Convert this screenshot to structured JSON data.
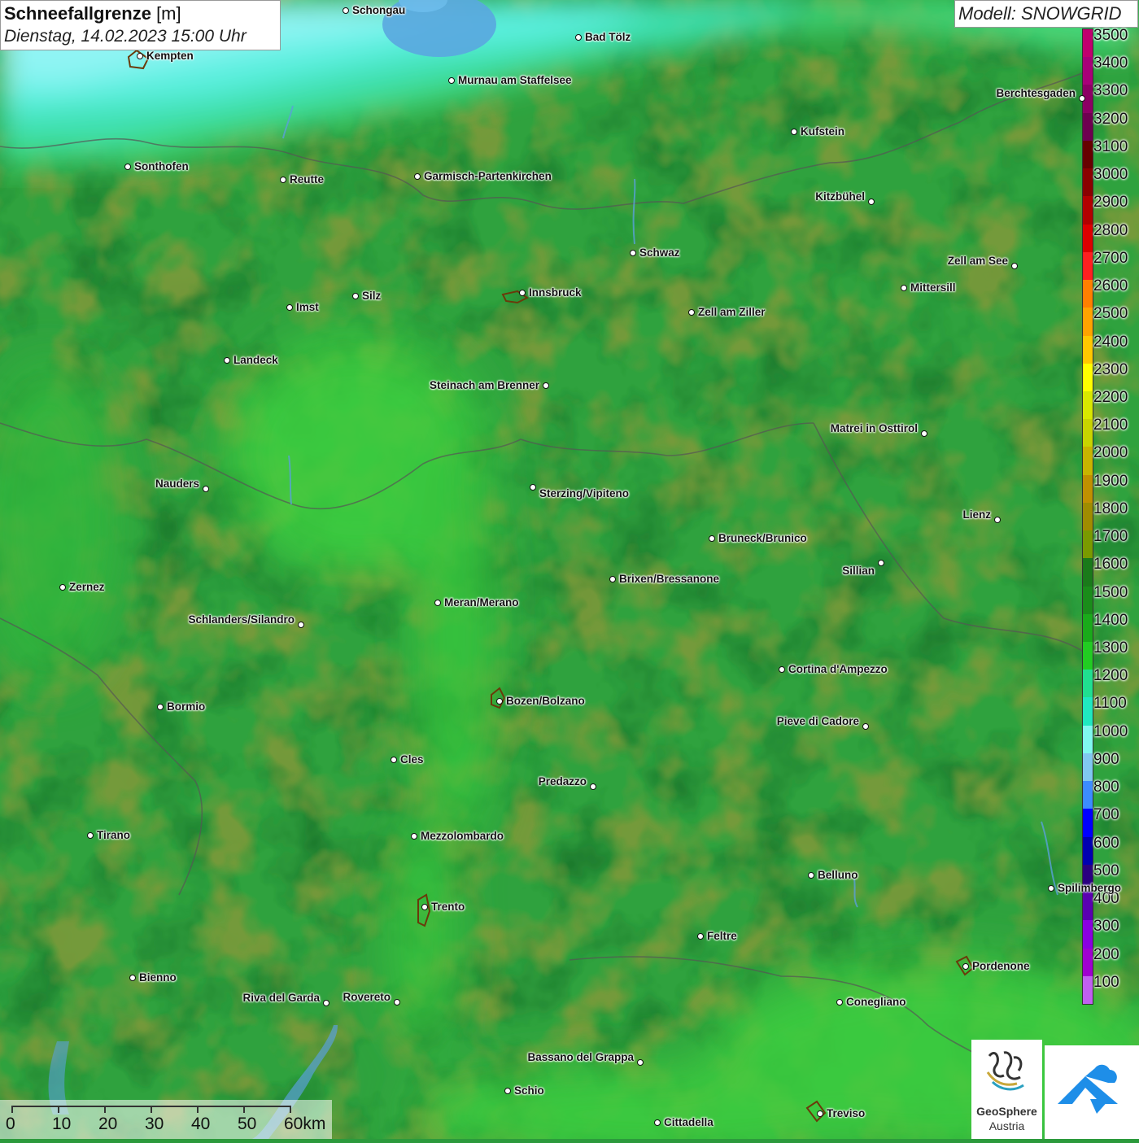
{
  "header": {
    "title_bold": "Schneefallgrenze",
    "title_unit": " [m]",
    "datetime": "Dienstag, 14.02.2023 15:00 Uhr",
    "model": "Modell: SNOWGRID"
  },
  "legend": {
    "labels": [
      "3500",
      "3400",
      "3300",
      "3200",
      "3100",
      "3000",
      "2900",
      "2800",
      "2700",
      "2600",
      "2500",
      "2400",
      "2300",
      "2200",
      "2100",
      "2000",
      "1900",
      "1800",
      "1700",
      "1600",
      "1500",
      "1400",
      "1300",
      "1200",
      "1100",
      "1000",
      "900",
      "800",
      "700",
      "600",
      "500",
      "400",
      "300",
      "200",
      "100"
    ],
    "colors": [
      "#c0006e",
      "#a80078",
      "#8c0064",
      "#6e0050",
      "#660000",
      "#8a0000",
      "#b30000",
      "#dd0000",
      "#ff2020",
      "#ff7f00",
      "#ffa300",
      "#ffc800",
      "#ffff00",
      "#d8e800",
      "#c8d400",
      "#c8b400",
      "#c09000",
      "#a08c00",
      "#7a9a00",
      "#1a7a1a",
      "#1a8c1a",
      "#1aaa1a",
      "#22cc22",
      "#20e090",
      "#20e8c0",
      "#80f8f0",
      "#80c8f0",
      "#3c8cff",
      "#0000ff",
      "#0000b0",
      "#2a0080",
      "#5a00b0",
      "#8a00e0",
      "#a000d0",
      "#c060f0"
    ]
  },
  "cities": [
    {
      "name": "Schongau",
      "side": "r"
    },
    {
      "name": "Bad Tölz",
      "side": "r"
    },
    {
      "name": "Kempten",
      "side": "r"
    },
    {
      "name": "Murnau am Staffelsee",
      "side": "r"
    },
    {
      "name": "Berchtesgaden",
      "side": "l"
    },
    {
      "name": "Kufstein",
      "side": "r"
    },
    {
      "name": "Sonthofen",
      "side": "r"
    },
    {
      "name": "Reutte",
      "side": "r"
    },
    {
      "name": "Garmisch-Partenkirchen",
      "side": "r"
    },
    {
      "name": "Kitzbühel",
      "side": "l"
    },
    {
      "name": "Schwaz",
      "side": "r"
    },
    {
      "name": "Zell am See",
      "side": "l"
    },
    {
      "name": "Innsbruck",
      "side": "r"
    },
    {
      "name": "Mittersill",
      "side": "r"
    },
    {
      "name": "Silz",
      "side": "r"
    },
    {
      "name": "Imst",
      "side": "r"
    },
    {
      "name": "Zell am Ziller",
      "side": "r"
    },
    {
      "name": "Landeck",
      "side": "r"
    },
    {
      "name": "Steinach am Brenner",
      "side": "l"
    },
    {
      "name": "Matrei in Osttirol",
      "side": "l"
    },
    {
      "name": "Nauders",
      "side": "l"
    },
    {
      "name": "Sterzing/Vipiteno",
      "side": "r"
    },
    {
      "name": "Lienz",
      "side": "l"
    },
    {
      "name": "Bruneck/Brunico",
      "side": "r"
    },
    {
      "name": "Sillian",
      "side": "l"
    },
    {
      "name": "Brixen/Bressanone",
      "side": "r"
    },
    {
      "name": "Zernez",
      "side": "r"
    },
    {
      "name": "Meran/Merano",
      "side": "r"
    },
    {
      "name": "Schlanders/Silandro",
      "side": "l"
    },
    {
      "name": "Cortina d'Ampezzo",
      "side": "r"
    },
    {
      "name": "Bozen/Bolzano",
      "side": "r"
    },
    {
      "name": "Bormio",
      "side": "r"
    },
    {
      "name": "Pieve di Cadore",
      "side": "l"
    },
    {
      "name": "Cles",
      "side": "r"
    },
    {
      "name": "Predazzo",
      "side": "l"
    },
    {
      "name": "Tirano",
      "side": "r"
    },
    {
      "name": "Mezzolombardo",
      "side": "r"
    },
    {
      "name": "Belluno",
      "side": "r"
    },
    {
      "name": "Spilimbergo",
      "side": "r"
    },
    {
      "name": "Trento",
      "side": "r"
    },
    {
      "name": "Feltre",
      "side": "r"
    },
    {
      "name": "Pordenone",
      "side": "r"
    },
    {
      "name": "Bienno",
      "side": "r"
    },
    {
      "name": "Riva del Garda",
      "side": "l"
    },
    {
      "name": "Rovereto",
      "side": "l"
    },
    {
      "name": "Conegliano",
      "side": "r"
    },
    {
      "name": "Bassano del Grappa",
      "side": "l"
    },
    {
      "name": "Schio",
      "side": "r"
    },
    {
      "name": "Treviso",
      "side": "r"
    },
    {
      "name": "Cittadella",
      "side": "r"
    }
  ],
  "scale": {
    "labels": [
      "0",
      "10",
      "20",
      "30",
      "40",
      "50",
      "60km"
    ]
  },
  "logo": {
    "name": "GeoSphere",
    "sub": "Austria"
  }
}
